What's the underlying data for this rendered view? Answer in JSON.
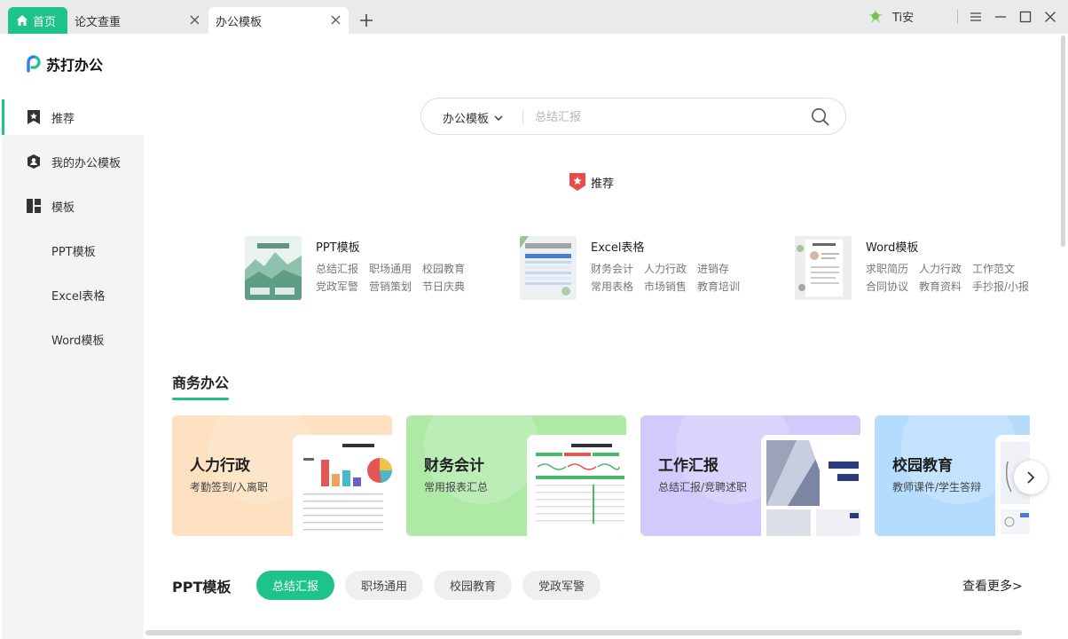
{
  "tabs": {
    "home": "首页",
    "t1": "论文查重",
    "t2": "办公模板"
  },
  "user": {
    "name": "Ti安"
  },
  "sidebar": {
    "logo": "苏打办公",
    "items": [
      "推荐",
      "我的办公模板",
      "模板",
      "PPT模板",
      "Excel表格",
      "Word模板"
    ]
  },
  "search": {
    "scope": "办公模板",
    "placeholder": "总结汇报"
  },
  "recommend": {
    "title": "推荐"
  },
  "categories": [
    {
      "title": "PPT模板",
      "row1": [
        "总结汇报",
        "职场通用",
        "校园教育"
      ],
      "row2": [
        "党政军警",
        "营销策划",
        "节日庆典"
      ]
    },
    {
      "title": "Excel表格",
      "row1": [
        "财务会计",
        "人力行政",
        "进销存"
      ],
      "row2": [
        "常用表格",
        "市场销售",
        "教育培训"
      ]
    },
    {
      "title": "Word模板",
      "row1": [
        "求职简历",
        "人力行政",
        "工作范文"
      ],
      "row2": [
        "合同协议",
        "教育资料",
        "手抄报/小报"
      ]
    }
  ],
  "business": {
    "title": "商务办公",
    "cards": [
      {
        "title": "人力行政",
        "sub": "考勤签到/入离职",
        "bg": "#fde0bf"
      },
      {
        "title": "财务会计",
        "sub": "常用报表汇总",
        "bg": "#aee9a6"
      },
      {
        "title": "工作汇报",
        "sub": "总结汇报/竞聘述职",
        "bg": "#d1cbfb"
      },
      {
        "title": "校园教育",
        "sub": "教师课件/学生答辩",
        "bg": "#b5dcfd"
      }
    ]
  },
  "ppt": {
    "title": "PPT模板",
    "chips": [
      "总结汇报",
      "职场通用",
      "校园教育",
      "党政军警"
    ],
    "more": "查看更多>"
  },
  "colors": {
    "accent": "#1ec28b",
    "danger": "#e94b4b"
  }
}
